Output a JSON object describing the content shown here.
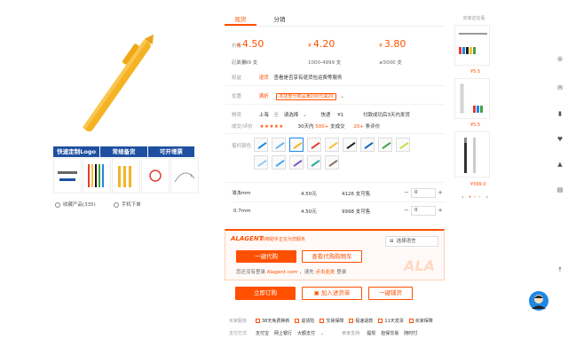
{
  "gallery": {
    "thumb_tabs": [
      "快速定制Logo",
      "常规备货",
      "可开增票"
    ],
    "favorite_label": "收藏产品(335)",
    "mobile_label": "手机下单"
  },
  "tabs": [
    "现货",
    "分销"
  ],
  "price": {
    "price_label": "价格",
    "moq_label": "起批量",
    "currency": "¥",
    "tiers": [
      {
        "price": "4.50",
        "qty": "2-999 支"
      },
      {
        "price": "4.20",
        "qty": "1000-4999 支"
      },
      {
        "price": "3.80",
        "qty": "≥5000 支"
      }
    ]
  },
  "rights": {
    "label": "权益",
    "badge": "退货",
    "text": "查看是否享有退货包运费等服务"
  },
  "promo": {
    "label": "优惠",
    "tag": "满折",
    "text": "本店部分商品满200元减20"
  },
  "shipping": {
    "label": "物流",
    "from": "上海",
    "to_prefix": "至",
    "to": "请选择",
    "method": "快递",
    "fee": "¥1",
    "note": "付款成功后3天内发货"
  },
  "reviews": {
    "label": "成交/评价",
    "stars": "★★★★★",
    "deals_prefix": "30天内",
    "deals_count": "500+",
    "deals_suffix": "支成交",
    "reviews_count": "20+",
    "reviews_suffix": "条评价"
  },
  "colors": {
    "label": "笔杆颜色"
  },
  "specs": {
    "label": "笔头",
    "rows": [
      {
        "name": "0.5mm",
        "price": "4.50元",
        "stock": "4126 支可售",
        "qty": "0"
      },
      {
        "name": "0.7mm",
        "price": "4.50元",
        "stock": "9998 支可售",
        "qty": "0"
      }
    ],
    "minus": "−",
    "plus": "+"
  },
  "agent": {
    "logo": "ALAGENT",
    "tagline": "购物助手正在为您服务",
    "language_select": "选择语言",
    "buy_button": "一键代购",
    "cart_button": "查看代购购物车",
    "note_prefix": "您还没有登录",
    "note_site": "Alagent.com",
    "note_mid": "，请先",
    "note_login_link": "点击此处",
    "note_suffix": "登录",
    "watermark": "ALA"
  },
  "actions": {
    "order_now": "立即订购",
    "add_to_cart": "加入进货单",
    "one_click": "一键铺货"
  },
  "footer": {
    "service_label": "买家服务",
    "services": [
      "38天免费换新",
      "退货险",
      "交易保障",
      "极速退款",
      "11天发货",
      "买家保障"
    ],
    "payment_label": "支付方式",
    "payments": [
      "支付宝",
      "网上银行",
      "大额支付"
    ],
    "support_label": "卖家支持",
    "supports": [
      "提现",
      "担保交易",
      "随时付"
    ]
  },
  "right_column": {
    "title": "买家还在看",
    "prices": [
      "¥5.5",
      "¥5.5",
      "¥399.0"
    ],
    "prev": "‹",
    "next": "›"
  },
  "colors_theme": {
    "accent": "#ff5000",
    "blue": "#1e4fa1"
  }
}
